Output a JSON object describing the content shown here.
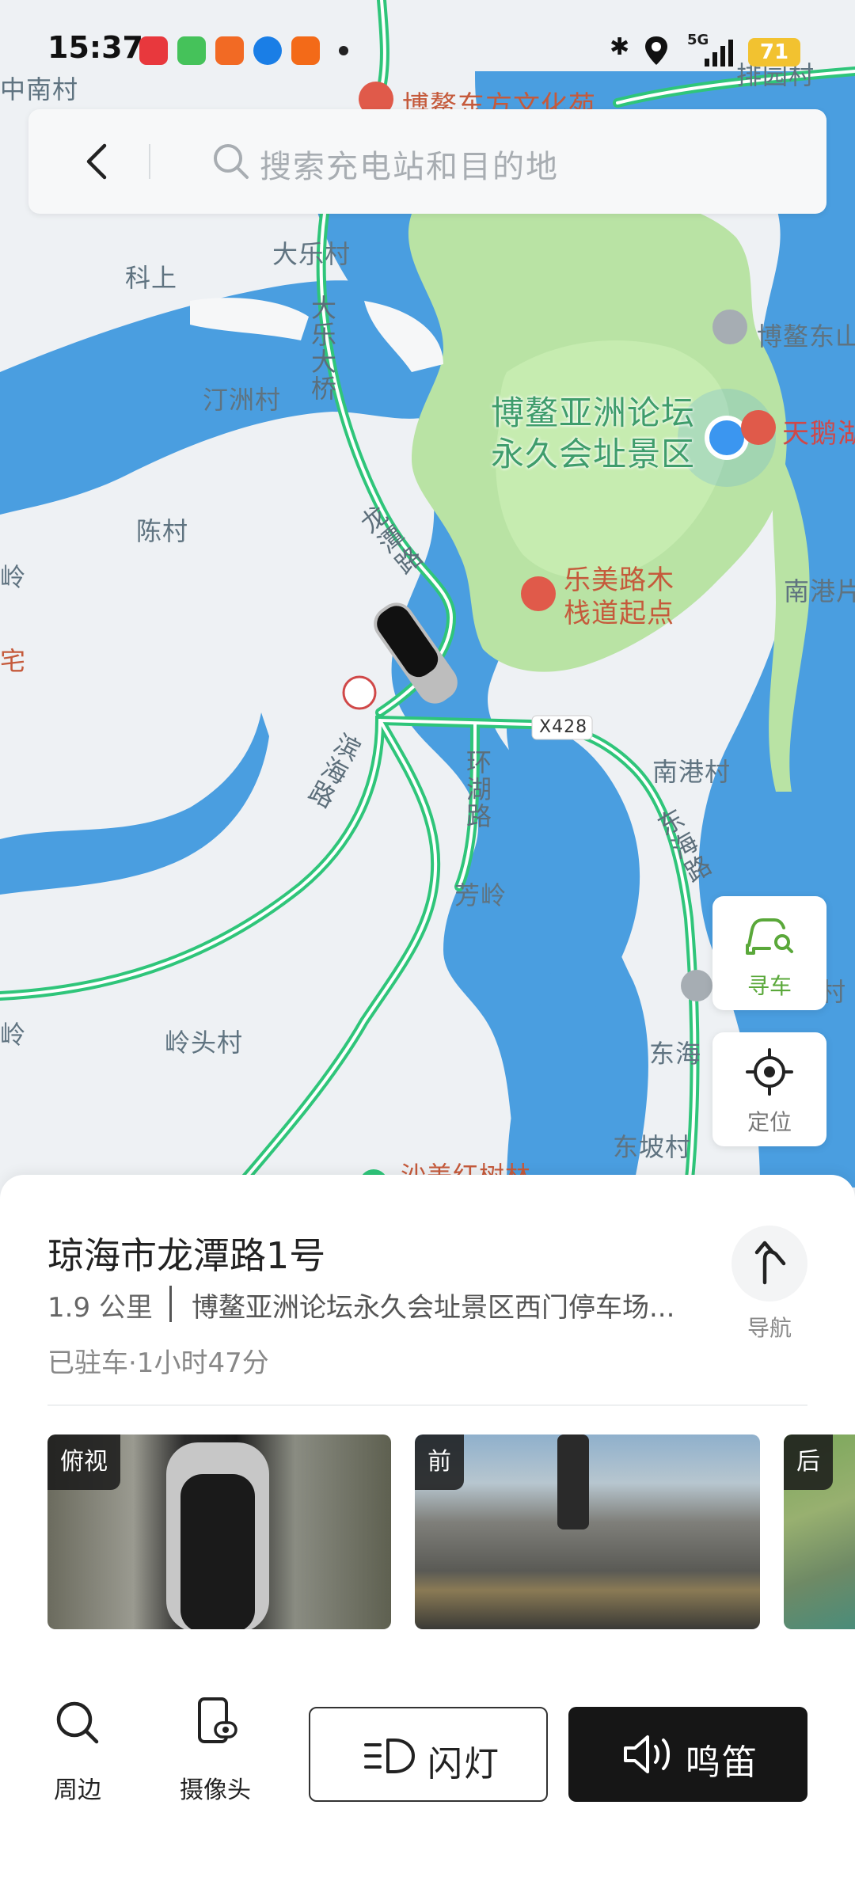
{
  "status_bar": {
    "time": "15:37",
    "battery": "71",
    "network": "5G"
  },
  "search": {
    "placeholder": "搜索充电站和目的地"
  },
  "map": {
    "labels": {
      "zhongnan": "中南村",
      "cultural": "博鳌东方文化苑",
      "paiyuan": "排园村",
      "dale": "大乐村",
      "keshang": "科上",
      "tingzhou": "汀洲村",
      "chen": "陈村",
      "lingleft": "岭",
      "zhai": "宅",
      "boaoeast": "博鳌东山",
      "tiane": "天鹅湖",
      "forum_line1": "博鳌亚洲论坛",
      "forum_line2": "永久会址景区",
      "lemei_line1": "乐美路木",
      "lemei_line2": "栈道起点",
      "nangang_port": "南港片",
      "nangang_village": "南港村",
      "fangling": "芳岭",
      "lingtou": "岭头村",
      "donghai": "东海",
      "dongpo": "东坡村",
      "cunright": "村",
      "shamei": "沙美红树林",
      "ling_small": "岭",
      "x428": "X428"
    },
    "roads": {
      "dale_bridge": "大乐大桥",
      "longtan": "龙潭路",
      "binhai": "滨海路",
      "huanhu": "环湖路",
      "donghai_road": "东海路"
    }
  },
  "buttons": {
    "find_car": "寻车",
    "locate": "定位"
  },
  "sheet": {
    "address": "琼海市龙潭路1号",
    "distance": "1.9 公里",
    "place": "博鳌亚洲论坛永久会址景区西门停车场...",
    "parked": "已驻车·1小时47分",
    "navigate": "导航",
    "cameras": [
      {
        "label": "俯视"
      },
      {
        "label": "前"
      },
      {
        "label": "后"
      }
    ],
    "actions": {
      "nearby": "周边",
      "camera": "摄像头",
      "flash": "闪灯",
      "honk": "鸣笛"
    }
  },
  "colors": {
    "water": "#4a9ee0",
    "park": "#b9e3a4",
    "road": "#2fc57a",
    "land": "#eef1f4",
    "location": "#3b96f0"
  }
}
